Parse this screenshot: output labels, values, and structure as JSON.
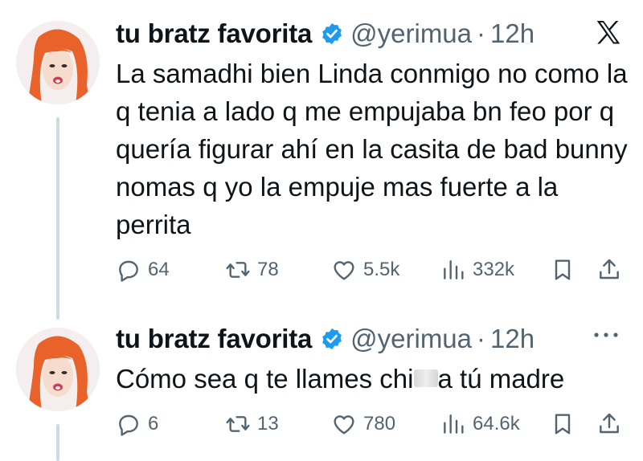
{
  "tweets": [
    {
      "display_name": "tu bratz favorita",
      "handle": "@yerimua",
      "separator": "·",
      "time": "12h",
      "text": "La samadhi bien Linda conmigo no como la q tenia a lado q me empujaba bn feo por q quería figurar ahí en la casita de bad bunny nomas q yo la empuje mas fuerte a la perrita",
      "replies": "64",
      "reposts": "78",
      "likes": "5.5k",
      "views": "332k"
    },
    {
      "display_name": "tu bratz favorita",
      "handle": "@yerimua",
      "separator": "·",
      "time": "12h",
      "text_before": "Cómo sea q te llames chi",
      "text_after": "a tú madre",
      "replies": "6",
      "reposts": "13",
      "likes": "780",
      "views": "64.6k"
    }
  ],
  "icons": {
    "verified": "verified-badge-icon",
    "platform": "x-logo-icon",
    "more": "more-options-icon",
    "reply": "reply-icon",
    "repost": "repost-icon",
    "like": "heart-icon",
    "views": "views-chart-icon",
    "bookmark": "bookmark-icon",
    "share": "share-icon"
  },
  "colors": {
    "text": "#0f1419",
    "secondary": "#536471",
    "verified": "#1d9bf0",
    "thread_line": "#cfd9de",
    "avatar_hair": "#e8622a"
  }
}
